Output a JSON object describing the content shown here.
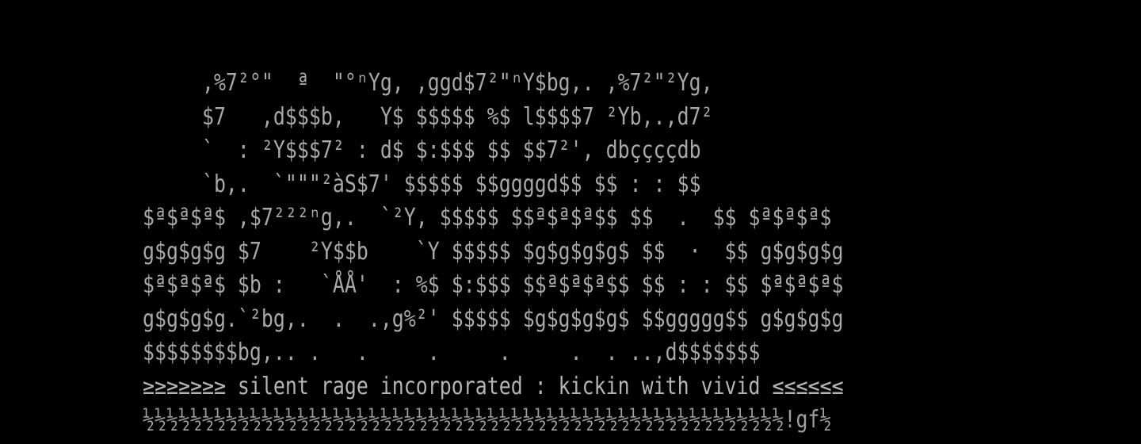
{
  "artwork": {
    "lines": [
      "     ,%7²°\"  ª  \"°ⁿYg, ,ggd$7²\"ⁿY$bg,. ,%7²\"²Yg,",
      "     $7   ,d$$$b,   Y$ $$$$$ %$ l$$$$7 ²Yb,.,d7²",
      "     `  : ²Y$$$7² : d$ $:$$$ $$ $$7²', dbççççdb",
      "     `b,.  `\"\"\"²àS$7' $$$$$ $$ggggd$$ $$ : : $$",
      "$ª$ª$ª$ ,$7²²²ⁿg,.  `²Y, $$$$$ $$ª$ª$ª$$ $$  .  $$ $ª$ª$ª$",
      "g$g$g$g $7    ²Y$$b    `Y $$$$$ $g$g$g$g$ $$  ·  $$ g$g$g$g",
      "$ª$ª$ª$ $b :   `ÅÅ'  : %$ $:$$$ $$ª$ª$ª$$ $$ : : $$ $ª$ª$ª$",
      "g$g$g$g.`²bg,.  .  .,g%²' $$$$$ $g$g$g$g$ $$ggggg$$ g$g$g$g",
      "$$$$$$$$bg,.. .   .     .     .     .  . ..,d$$$$$$$",
      "≥≥≥≥≥≥≥ silent rage incorporated : kickin with vivid ≤≤≤≤≤≤",
      "½½½½½½½½½½½½½½½½½½½½½½½½½½½½½½½½½½½½½½½½½½½½½½½½½½½½½½!gf½"
    ]
  },
  "colors": {
    "background": "#000000",
    "text": "#a8a8a8"
  }
}
